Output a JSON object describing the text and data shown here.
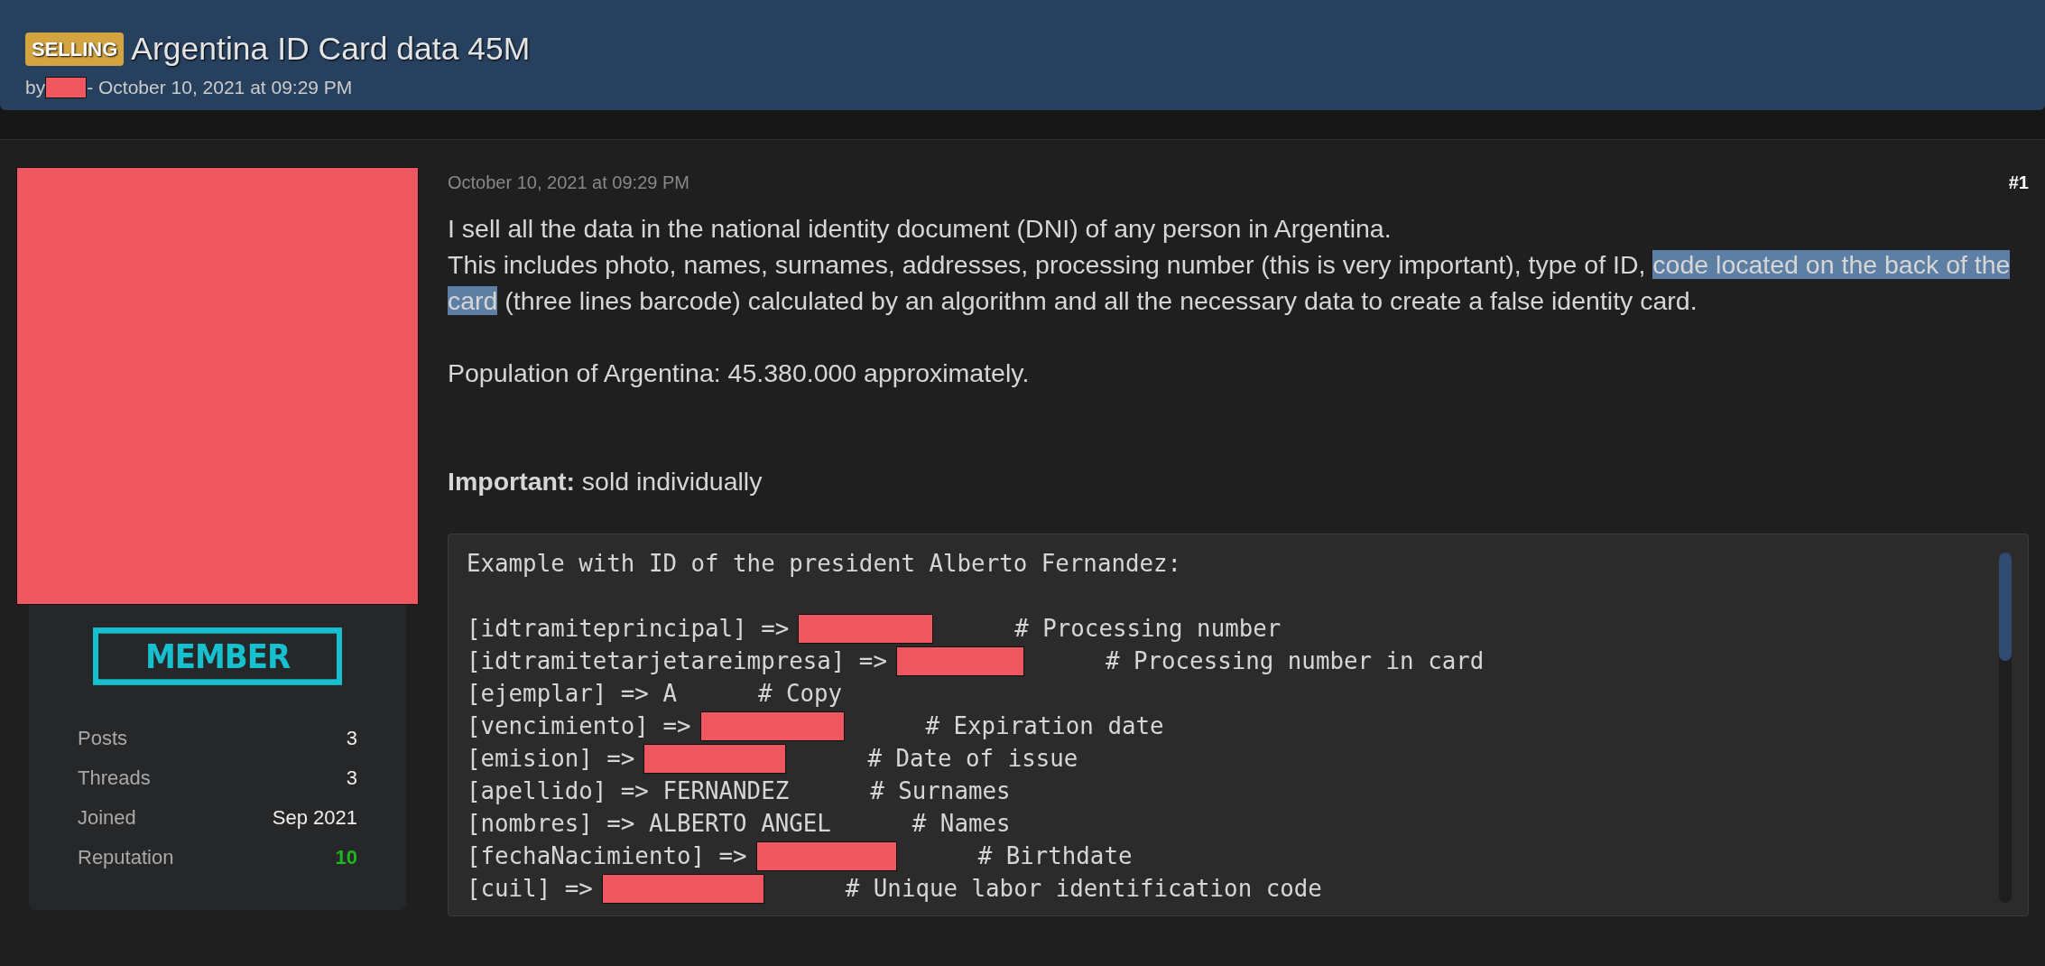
{
  "thread": {
    "prefix": "SELLING",
    "title": "Argentina ID Card data 45M",
    "by": "by",
    "author_redacted": true,
    "date": "- October 10, 2021 at 09:29 PM"
  },
  "author": {
    "avatar_redacted": true,
    "rank": "MEMBER",
    "stats": [
      {
        "label": "Posts",
        "value": "3",
        "kind": "plain"
      },
      {
        "label": "Threads",
        "value": "3",
        "kind": "plain"
      },
      {
        "label": "Joined",
        "value": "Sep 2021",
        "kind": "plain"
      },
      {
        "label": "Reputation",
        "value": "10",
        "kind": "positive"
      }
    ]
  },
  "post": {
    "date": "October 10, 2021 at 09:29 PM",
    "number": "#1",
    "paragraphs": [
      {
        "kind": "text",
        "segments": [
          {
            "text": "I sell all the data in the national identity document (DNI) of any person in Argentina.",
            "selected": false
          }
        ]
      },
      {
        "kind": "text",
        "segments": [
          {
            "text": "This includes photo, names, surnames, addresses, processing number (this is very important), type of ID, ",
            "selected": false
          },
          {
            "text": "code located on the back of the card",
            "selected": true
          },
          {
            "text": " (three lines barcode) calculated by an algorithm and all the necessary data to create a false identity card.",
            "selected": false
          }
        ]
      },
      {
        "kind": "gap"
      },
      {
        "kind": "text",
        "segments": [
          {
            "text": "Population of Argentina: 45.380.000 approximately.",
            "selected": false
          }
        ]
      },
      {
        "kind": "gap"
      },
      {
        "kind": "gap"
      },
      {
        "kind": "text",
        "segments": [
          {
            "text": "**Important:** sold individually",
            "selected": false
          }
        ]
      }
    ],
    "code": {
      "heading": "Example with ID of the president Alberto Fernandez:",
      "lines": [
        {
          "key": "[idtramiteprincipal] =>",
          "redacted": true,
          "comment": "# Processing number"
        },
        {
          "key": "[idtramitetarjetareimpresa] =>",
          "redacted": true,
          "comment": "# Processing number in card"
        },
        {
          "key": "[ejemplar] => A",
          "redacted": false,
          "comment": "# Copy"
        },
        {
          "key": "[vencimiento] =>",
          "redacted": true,
          "comment": "# Expiration date"
        },
        {
          "key": "[emision] =>",
          "redacted": true,
          "comment": "# Date of issue"
        },
        {
          "key": "[apellido] => FERNANDEZ",
          "redacted": false,
          "comment": "# Surnames"
        },
        {
          "key": "[nombres] => ALBERTO ANGEL",
          "redacted": false,
          "comment": "# Names"
        },
        {
          "key": "[fechaNacimiento] =>",
          "redacted": true,
          "comment": "# Birthdate"
        },
        {
          "key": "[cuil] =>",
          "redacted": true,
          "comment": "# Unique labor identification code"
        }
      ]
    }
  }
}
